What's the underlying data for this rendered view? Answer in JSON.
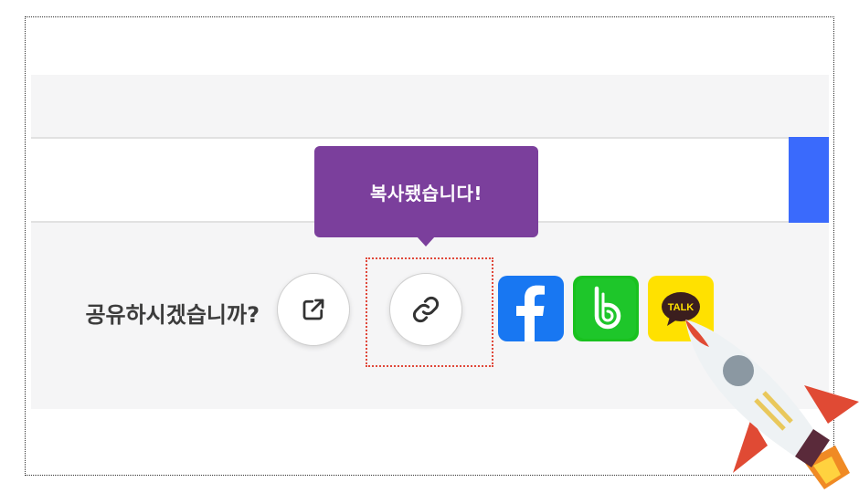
{
  "tooltip": {
    "text": "복사됐습니다!"
  },
  "share": {
    "question": "공유하시겠습니까?",
    "buttons": [
      {
        "name": "open-link-button",
        "icon": "external-link-icon"
      },
      {
        "name": "copy-link-button",
        "icon": "link-icon"
      },
      {
        "name": "facebook-share-button",
        "icon": "facebook-icon",
        "color": "#1877f2"
      },
      {
        "name": "band-share-button",
        "icon": "band-icon",
        "color": "#19c11f"
      },
      {
        "name": "kakaotalk-share-button",
        "icon": "kakaotalk-icon",
        "color": "#ffe100"
      }
    ]
  },
  "kakao": {
    "badge": "TALK"
  },
  "colors": {
    "tooltip_bg": "#7b3f9c",
    "accent_blue": "#3a6afc",
    "highlight_border": "#e0483a"
  }
}
